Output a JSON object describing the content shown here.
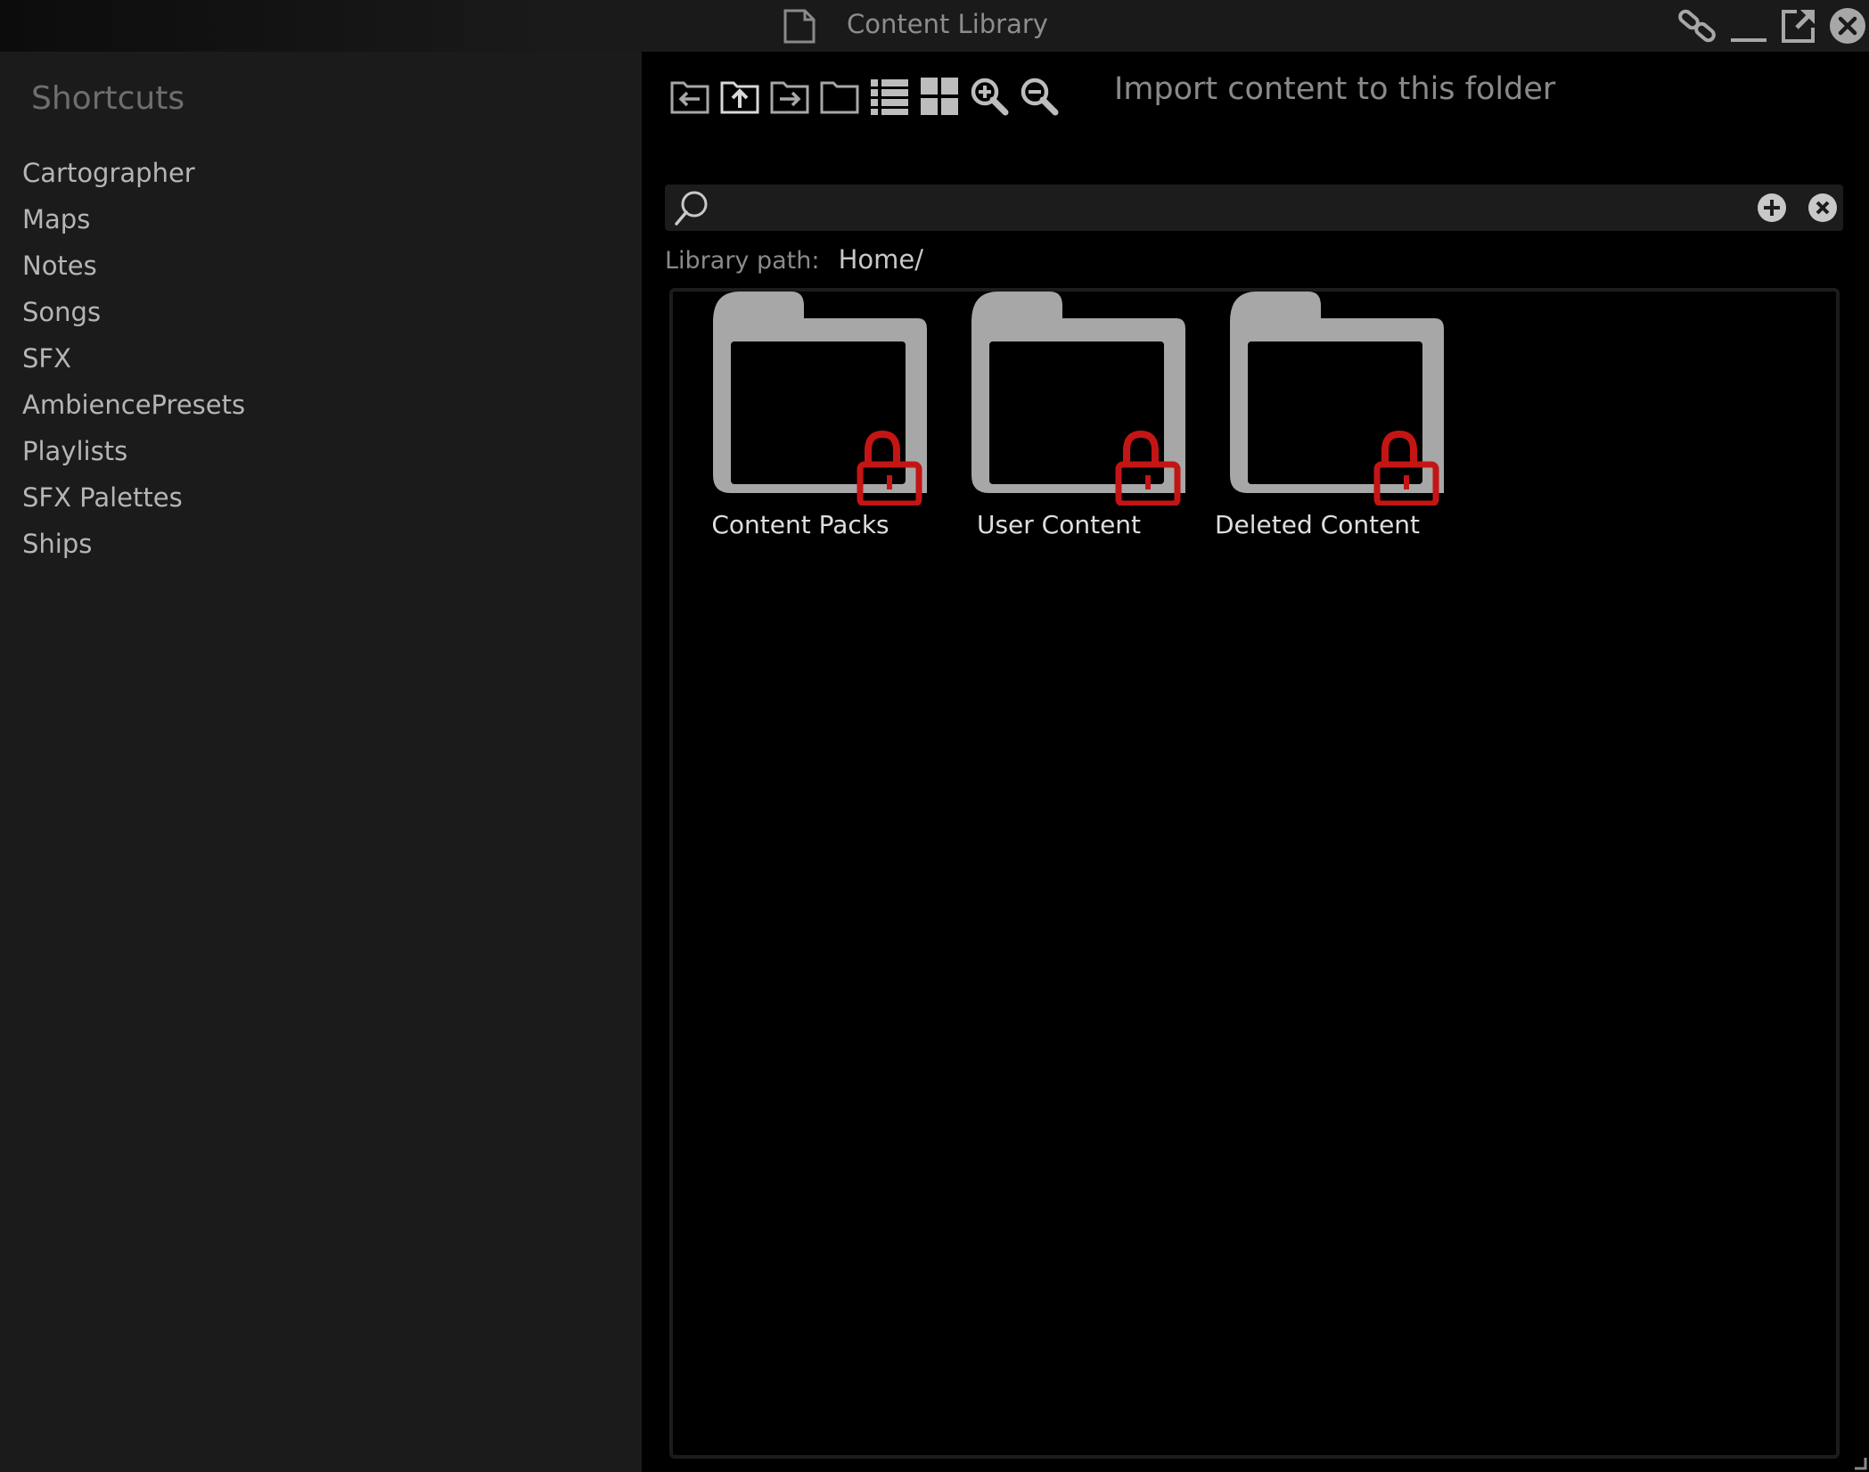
{
  "window": {
    "title": "Content Library",
    "icons": [
      "document-icon",
      "link-icon",
      "minimize-icon",
      "popout-icon",
      "close-icon"
    ]
  },
  "sidebar": {
    "title": "Shortcuts",
    "items": [
      {
        "label": "Cartographer"
      },
      {
        "label": "Maps"
      },
      {
        "label": "Notes"
      },
      {
        "label": "Songs"
      },
      {
        "label": "SFX"
      },
      {
        "label": "AmbiencePresets"
      },
      {
        "label": "Playlists"
      },
      {
        "label": "SFX Palettes"
      },
      {
        "label": "Ships"
      }
    ]
  },
  "toolbar": {
    "buttons": [
      "back-icon",
      "up-folder-icon",
      "forward-icon",
      "new-folder-icon",
      "list-view-icon",
      "grid-view-icon",
      "zoom-in-icon",
      "zoom-out-icon"
    ],
    "import_label": "Import content to this folder"
  },
  "search": {
    "value": "",
    "placeholder": ""
  },
  "path": {
    "label": "Library path:",
    "value": "Home/"
  },
  "folders": [
    {
      "label": "Content Packs",
      "locked": true
    },
    {
      "label": "User Content",
      "locked": true
    },
    {
      "label": "Deleted Content",
      "locked": true
    }
  ],
  "colors": {
    "lock": "#c41515",
    "folder": "#a7a7a7",
    "sidebar_bg": "#1b1b1b",
    "main_bg": "#000000"
  }
}
